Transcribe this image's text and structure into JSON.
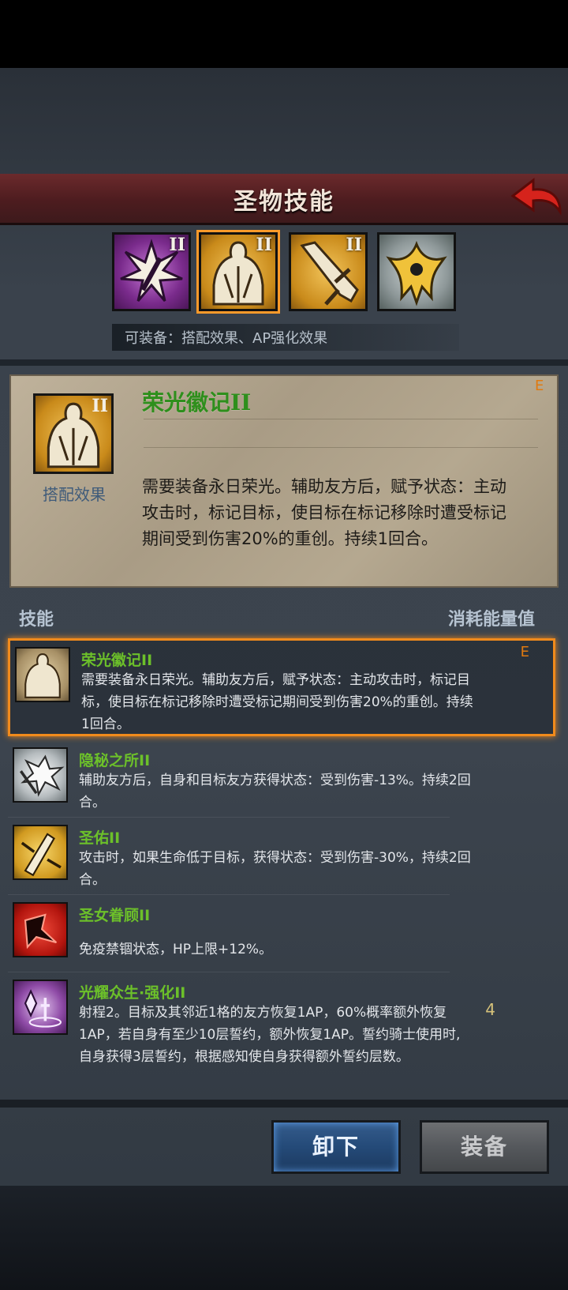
{
  "header": {
    "title": "圣物技能"
  },
  "relic_slots": [
    {
      "tier": "II",
      "color": "#9a3db0",
      "icon": "starburst-icon"
    },
    {
      "tier": "II",
      "color": "#d49a2a",
      "icon": "knight-bust-icon",
      "selected": true
    },
    {
      "tier": "II",
      "color": "#d49a2a",
      "icon": "sword-icon"
    },
    {
      "tier": "",
      "color": "#9ba3a2",
      "icon": "golden-crest-icon"
    }
  ],
  "equippable": {
    "text": "可装备：搭配效果、AP强化效果"
  },
  "detail": {
    "title": "荣光徽记II",
    "grade": "E",
    "icon_tier": "II",
    "icon_label": "搭配效果",
    "description": "需要装备永日荣光。辅助友方后，赋予状态：主动攻击时，标记目标，使目标在标记移除时遭受标记期间受到伤害20%的重创。持续1回合。"
  },
  "columns": {
    "skill": "技能",
    "cost": "消耗能量值"
  },
  "skills": [
    {
      "name": "荣光徽记II",
      "grade": "E",
      "cost": "",
      "description": "需要装备永日荣光。辅助友方后，赋予状态：主动攻击时，标记目标，使目标在标记移除时遭受标记期间受到伤害20%的重创。持续1回合。"
    },
    {
      "name": "隐秘之所II",
      "grade": "",
      "cost": "",
      "description": "辅助友方后，自身和目标友方获得状态：受到伤害-13%。持续2回合。"
    },
    {
      "name": "圣佑II",
      "grade": "",
      "cost": "",
      "description": "攻击时，如果生命低于目标，获得状态：受到伤害-30%，持续2回合。"
    },
    {
      "name": "圣女眷顾II",
      "grade": "",
      "cost": "",
      "description": "免疫禁锢状态，HP上限+12%。"
    },
    {
      "name": "光耀众生·强化II",
      "grade": "",
      "cost": "4",
      "description": "射程2。目标及其邻近1格的友方恢复1AP，60%概率额外恢复1AP，若自身有至少10层誓约，额外恢复1AP。誓约骑士使用时,自身获得3层誓约，根据感知使自身获得额外誓约层数。"
    }
  ],
  "buttons": {
    "unequip": "卸下",
    "equip": "装备"
  },
  "colors": {
    "accent_orange": "#f08a1c",
    "skill_name_green": "#6cc02a",
    "header_red": "#5a2225"
  }
}
